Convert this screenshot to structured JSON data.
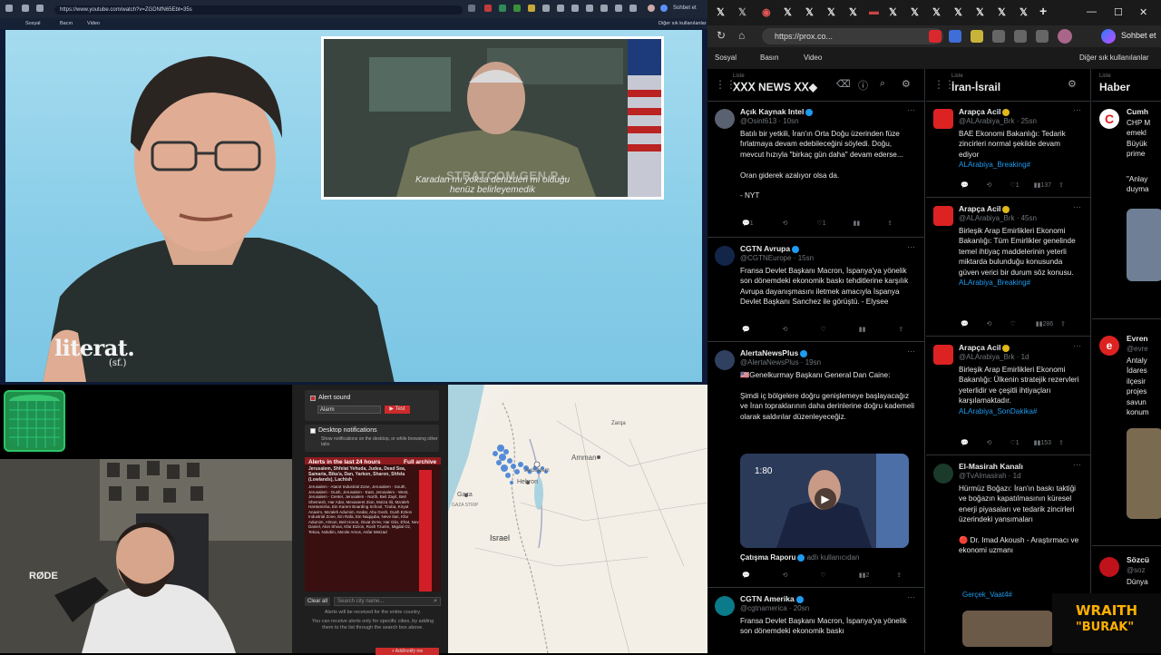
{
  "youtube_browser": {
    "url": "https://www.youtube.com/watch?v=ZGDNfN65Ebt=35s",
    "profile_label": "Sohbet et",
    "bookmarks": [
      "Sosyal",
      "Bacın",
      "Video"
    ],
    "bookmarks_right": "Diğer sık kullanılanlar"
  },
  "video": {
    "pip_overlay_text": "STRATCOM GEN P...",
    "subtitle_line1": "Karadan mı yoksa denizden mi olduğu",
    "subtitle_line2": "henüz belirleyemedik",
    "channel_logo": "literat.",
    "channel_logo_sub": "(sf.)"
  },
  "alert_panel": {
    "alert_sound_label": "Alert sound",
    "alarm_select": "Alarm",
    "test_button": "▶ Test",
    "desktop_notifications_label": "Desktop notifications",
    "desktop_notifications_desc": "Show notifications on the desktop, or while browsing other tabs",
    "last24_label": "Alerts in the last 24 hours",
    "full_archive_link": "Full archive",
    "alerts_regions": "Jerusalem, Shfelat Yehuda, Judea, Dead Sea, Samaria, Bika'a, Dan, Yarkon, Sharon, Shfela (Lowlands), Lachish",
    "alerts_text": "Jerusalem - Atarot Industrial Zone, Jerusalem - South, Jerusalem - Gush, Jerusalem - East, Jerusalem - West, Jerusalem - Center, Jerusalem - North, Beit Zayit, Beit Shemesh, Har Adar, Mevaseret Zion, Motza Ilit, Ma'aleh HaHamisha, Ein Karem Boarding School, Tzuba, Kiryat Anavim, Ma'aleh Adumim, Kedar, Abu Gosh, Gush Eztion Industrial Zone, Ein Rafa, Ein Naqquba, Neve Ilan, Kfar Adumim, Almon, Beit Horon, Givat Ze'ev, Har Gilo, Efrat, Neve Daniel, Alon Shvut, Kfar Etzion, Rosh Tzurim, Migdal Oz, Tekoa, Nokdim, Ma'ale Amos, Asfar Metzad",
    "clear_all": "Clear all",
    "search_placeholder": "Search city name...",
    "entire_country_note": "Alerts will be received for the entire country.",
    "specific_cities_note": "You can receive alerts only for specific cities, by adding them to the list through the search box above.",
    "add_button": "+ Add/notify me"
  },
  "map": {
    "labels": [
      "Amman",
      "Jerusalem",
      "Hebron",
      "Gaza",
      "GAZA STRIP",
      "Israel",
      "Zarqa"
    ]
  },
  "edge_browser": {
    "url": "https://prox.co...",
    "profile_label": "Sohbet et",
    "bookmarks": [
      "Sosyal",
      "Basın",
      "Video"
    ],
    "bookmarks_right": "Diğer sık kullanılanlar"
  },
  "columns": [
    {
      "sub": "Liste",
      "title": "ꓫꓫꓫ NEWS ꓫꓫ◆",
      "tweets": [
        {
          "name": "Açık Kaynak Intel",
          "handle": "@Osint613 · 10sn",
          "text": "Batılı bir yetkili, İran'ın Orta Doğu üzerinden füze fırlatmaya devam edebileceğini söyledi. Doğu, mevcut hızıyla \"birkaç gün daha\" devam ederse...\n\nOran giderek azalıyor olsa da.\n\n- NYT",
          "replies": "1",
          "likes": "1"
        },
        {
          "name": "CGTN Avrupa",
          "handle": "@CGTNEurope · 15sn",
          "text": "Fransa Devlet Başkanı Macron, İspanya'ya yönelik son dönemdeki ekonomik baskı tehditlerine karşılık Avrupa dayanışmasını iletmek amacıyla İspanya Devlet Başkanı Sanchez ile görüştü. - Elysee"
        },
        {
          "name": "AlertaNewsPlus",
          "handle": "@AlertaNewsPlus · 19sn",
          "text": "🇺🇸Genelkurmay Başkanı General Dan Caine:\n\nŞimdi iç bölgelere doğru genişlemeye başlayacağız ve İran topraklarının daha derinlerine doğru kademeli olarak saldırılar düzenleyeceğiz.",
          "video_time": "1:80",
          "quote_name": "Çatışma Raporu",
          "quote_handle": "adlı kullanıcıdan",
          "views": "2"
        },
        {
          "name": "CGTN Amerika",
          "handle": "@cgtnamerica · 20sn",
          "text": "Fransa Devlet Başkanı Macron, İspanya'ya yönelik son dönemdeki ekonomik baskı"
        }
      ]
    },
    {
      "sub": "Liste",
      "title": "İran-İsrail",
      "tweets": [
        {
          "name": "Arapça Acil",
          "handle": "@ALArabiya_Brk · 25sn",
          "text": "BAE Ekonomi Bakanlığı: Tedarik zincirleri normal şekilde devam ediyor",
          "tag": "ALArabiya_Breaking#",
          "likes": "1",
          "views": "137"
        },
        {
          "name": "Arapça Acil",
          "handle": "@ALArabiya_Brk · 45sn",
          "text": "Birleşik Arap Emirlikleri Ekonomi Bakanlığı: Tüm Emirlikler genelinde temel ihtiyaç maddelerinin yeterli miktarda bulunduğu konusunda güven verici bir durum söz konusu.",
          "tag": "ALArabiya_Breaking#",
          "views": "286"
        },
        {
          "name": "Arapça Acil",
          "handle": "@ALArabiya_Brk · 1d",
          "text": "Birleşik Arap Emirlikleri Ekonomi Bakanlığı: Ülkenin stratejik rezervleri yeterlidir ve çeşitli ihtiyaçları karşılamaktadır.",
          "tag": "ALArabiya_SonDakika#",
          "likes": "1",
          "views": "153"
        },
        {
          "name": "El-Masirah Kanalı",
          "handle": "@TvAlmasirah · 1d",
          "text": "Hürmüz Boğazı: İran'ın baskı taktiği ve boğazın kapatılmasının küresel enerji piyasaları ve tedarik zincirleri üzerindeki yansımaları\n\n🔴 Dr. Imad Akoush - Araştırmacı ve ekonomi uzmanı",
          "tag": "Gerçek_Vaat4#"
        }
      ]
    },
    {
      "sub": "Liste",
      "title": "Haber",
      "tweets": [
        {
          "name": "Cumh",
          "text": "CHP M\nemekl\nBüyük\nprime"
        },
        {
          "name": "",
          "text": "\"Anlay\nduyma"
        },
        {
          "name": "Evren",
          "handle": "@evre",
          "text": "Antaly\nİdares\nilçesir\nprojes\nsavun\nkonum"
        },
        {
          "name": "Sözcü",
          "handle": "@soz",
          "text": "Dünya"
        }
      ]
    }
  ],
  "overlay": {
    "line1": "WRAITH",
    "line2": "\"BURAK\""
  },
  "colors": {
    "x_blue": "#1d9bf0",
    "alert_red": "#d21f27",
    "dark_bg": "#000000"
  }
}
